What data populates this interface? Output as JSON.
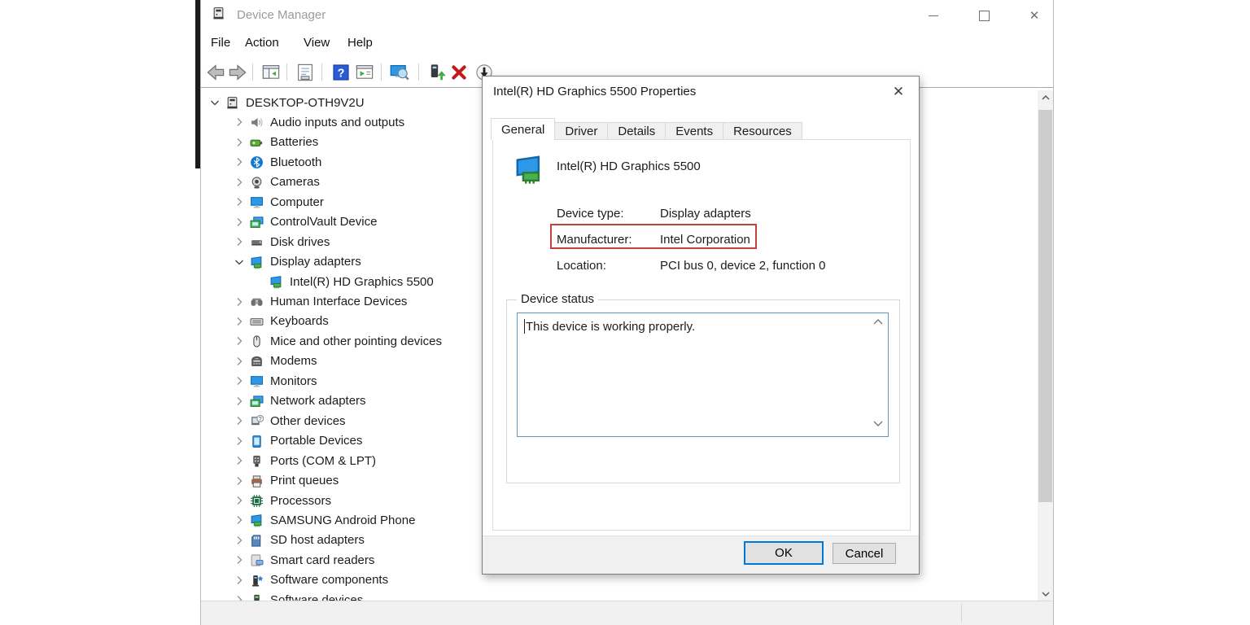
{
  "window": {
    "title": "Device Manager",
    "controls": [
      "minimize",
      "maximize",
      "close"
    ]
  },
  "menu": {
    "items": [
      "File",
      "Action",
      "View",
      "Help"
    ]
  },
  "toolbar": {
    "items": [
      {
        "icon": "back-arrow"
      },
      {
        "icon": "forward-arrow"
      },
      {
        "sep": true
      },
      {
        "icon": "show-console-tree"
      },
      {
        "sep": true
      },
      {
        "icon": "properties"
      },
      {
        "sep": true
      },
      {
        "icon": "help"
      },
      {
        "icon": "action-list"
      },
      {
        "sep": true
      },
      {
        "icon": "scan-hardware-changes"
      },
      {
        "sep": true
      },
      {
        "icon": "update-driver"
      },
      {
        "icon": "uninstall-device"
      },
      {
        "icon": "disable-device"
      }
    ]
  },
  "tree": {
    "items": [
      {
        "label": "DESKTOP-OTH9V2U",
        "icon": "computer",
        "level": 0,
        "expand": "open"
      },
      {
        "label": "Audio inputs and outputs",
        "icon": "audio",
        "level": 1,
        "expand": "closed"
      },
      {
        "label": "Batteries",
        "icon": "battery",
        "level": 1,
        "expand": "closed"
      },
      {
        "label": "Bluetooth",
        "icon": "bluetooth",
        "level": 1,
        "expand": "closed"
      },
      {
        "label": "Cameras",
        "icon": "camera",
        "level": 1,
        "expand": "closed"
      },
      {
        "label": "Computer",
        "icon": "monitor",
        "level": 1,
        "expand": "closed"
      },
      {
        "label": "ControlVault Device",
        "icon": "dual-monitor",
        "level": 1,
        "expand": "closed"
      },
      {
        "label": "Disk drives",
        "icon": "disk",
        "level": 1,
        "expand": "closed"
      },
      {
        "label": "Display adapters",
        "icon": "display-adapter",
        "level": 1,
        "expand": "open"
      },
      {
        "label": "Intel(R) HD Graphics 5500",
        "icon": "display-adapter",
        "level": 2,
        "expand": "none"
      },
      {
        "label": "Human Interface Devices",
        "icon": "hid",
        "level": 1,
        "expand": "closed"
      },
      {
        "label": "Keyboards",
        "icon": "keyboard",
        "level": 1,
        "expand": "closed"
      },
      {
        "label": "Mice and other pointing devices",
        "icon": "mouse",
        "level": 1,
        "expand": "closed"
      },
      {
        "label": "Modems",
        "icon": "modem",
        "level": 1,
        "expand": "closed"
      },
      {
        "label": "Monitors",
        "icon": "monitor",
        "level": 1,
        "expand": "closed"
      },
      {
        "label": "Network adapters",
        "icon": "dual-monitor",
        "level": 1,
        "expand": "closed"
      },
      {
        "label": "Other devices",
        "icon": "unknown-device",
        "level": 1,
        "expand": "closed"
      },
      {
        "label": "Portable Devices",
        "icon": "portable",
        "level": 1,
        "expand": "closed"
      },
      {
        "label": "Ports (COM & LPT)",
        "icon": "port",
        "level": 1,
        "expand": "closed"
      },
      {
        "label": "Print queues",
        "icon": "printer",
        "level": 1,
        "expand": "closed"
      },
      {
        "label": "Processors",
        "icon": "processor",
        "level": 1,
        "expand": "closed"
      },
      {
        "label": "SAMSUNG Android Phone",
        "icon": "display-adapter",
        "level": 1,
        "expand": "closed"
      },
      {
        "label": "SD host adapters",
        "icon": "sd-card",
        "level": 1,
        "expand": "closed"
      },
      {
        "label": "Smart card readers",
        "icon": "smart-card",
        "level": 1,
        "expand": "closed"
      },
      {
        "label": "Software components",
        "icon": "software-component",
        "level": 1,
        "expand": "closed"
      },
      {
        "label": "Software devices",
        "icon": "software-device",
        "level": 1,
        "expand": "closed"
      }
    ]
  },
  "dialog": {
    "title": "Intel(R) HD Graphics 5500 Properties",
    "tabs": [
      {
        "label": "General",
        "active": true
      },
      {
        "label": "Driver",
        "active": false
      },
      {
        "label": "Details",
        "active": false
      },
      {
        "label": "Events",
        "active": false
      },
      {
        "label": "Resources",
        "active": false
      }
    ],
    "device_name": "Intel(R) HD Graphics 5500",
    "fields": [
      {
        "label": "Device type:",
        "value": "Display adapters",
        "highlighted": false
      },
      {
        "label": "Manufacturer:",
        "value": "Intel Corporation",
        "highlighted": true
      },
      {
        "label": "Location:",
        "value": "PCI bus 0, device 2, function 0",
        "highlighted": false
      }
    ],
    "status": {
      "group_label": "Device status",
      "text": "This device is working properly."
    },
    "buttons": {
      "ok": "OK",
      "cancel": "Cancel"
    }
  },
  "colors": {
    "accent": "#0078d7",
    "highlight_box": "#c0443c",
    "status_border": "#5f97c5",
    "uninstall_red": "#c11b17"
  }
}
